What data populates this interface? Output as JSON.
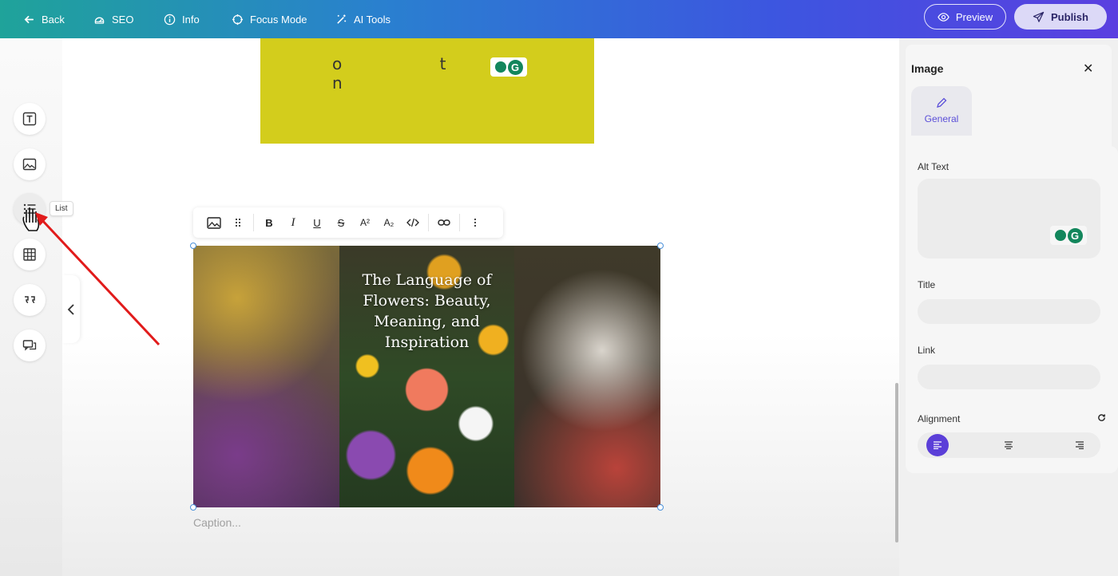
{
  "topbar": {
    "back_label": "Back",
    "seo_label": "SEO",
    "info_label": "Info",
    "focus_label": "Focus Mode",
    "ai_label": "AI Tools",
    "preview_label": "Preview",
    "publish_label": "Publish"
  },
  "leftrail": {
    "tooltip": "List",
    "tools": [
      "text-icon",
      "image-icon",
      "list-icon",
      "table-icon",
      "quote-icon",
      "comment-icon"
    ]
  },
  "canvas": {
    "yellow_text": "o t n",
    "image_title": "The Language of Flowers: Beauty, Meaning, and Inspiration",
    "caption_placeholder": "Caption..."
  },
  "toolbar": {
    "bold": "B",
    "italic": "I",
    "underline": "U",
    "strike": "S",
    "superscript": "A²",
    "subscript": "A₂"
  },
  "panel": {
    "title": "Image",
    "close": "✕",
    "tab_general": "General",
    "alt_label": "Alt Text",
    "title_label": "Title",
    "link_label": "Link",
    "alignment_label": "Alignment",
    "alignment_selected": "left"
  },
  "colors": {
    "accent": "#5b3fd8",
    "yellow_block": "#d3cd1c",
    "grammarly": "#13865c",
    "arrow": "#e11b1b"
  }
}
